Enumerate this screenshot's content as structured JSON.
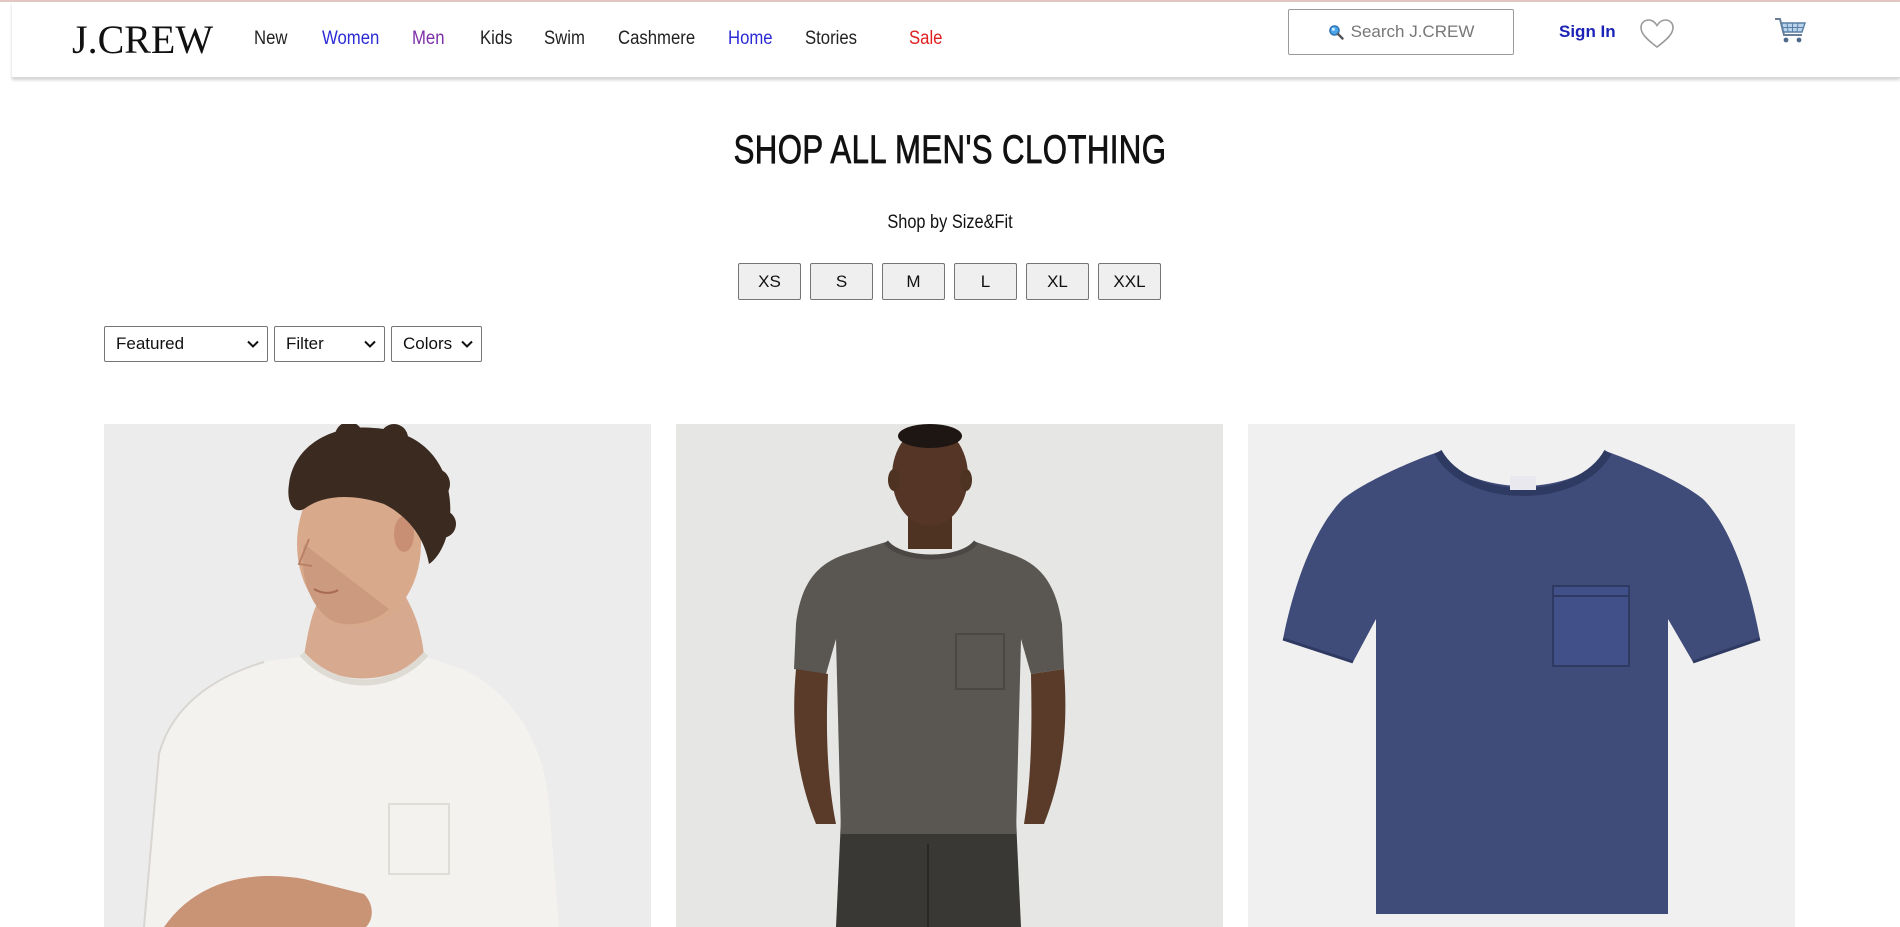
{
  "brand": {
    "logo": "J.CREW"
  },
  "nav": {
    "items": [
      {
        "label": "New",
        "color": "#222222"
      },
      {
        "label": "Women",
        "color": "#2b2bd6"
      },
      {
        "label": "Men",
        "color": "#7b2fa8"
      },
      {
        "label": "Kids",
        "color": "#222222"
      },
      {
        "label": "Swim",
        "color": "#222222"
      },
      {
        "label": "Cashmere",
        "color": "#222222"
      },
      {
        "label": "Home",
        "color": "#2b2bd6"
      },
      {
        "label": "Stories",
        "color": "#222222"
      },
      {
        "label": "Sale",
        "color": "#e02020"
      }
    ]
  },
  "header": {
    "search_placeholder": "Search J.CREW",
    "sign_in": "Sign In",
    "wishlist_icon": "heart-icon",
    "cart_icon": "shopping-cart-icon"
  },
  "main": {
    "title": "SHOP ALL MEN'S CLOTHING",
    "size_heading": "Shop by Size&Fit",
    "sizes": [
      "XS",
      "S",
      "M",
      "L",
      "XL",
      "XXL"
    ],
    "sort": {
      "value": "Featured"
    },
    "filter": {
      "value": "Filter"
    },
    "colors": {
      "value": "Colors"
    }
  },
  "products": [
    {
      "image": "model in white crewneck t-shirt, arms crossed",
      "shirt_color": "#f3f1ee"
    },
    {
      "image": "model in dark grey pocket t-shirt and dark jeans",
      "shirt_color": "#5a5753"
    },
    {
      "image": "navy pocket t-shirt flat lay",
      "shirt_color": "#3f4b78"
    }
  ]
}
